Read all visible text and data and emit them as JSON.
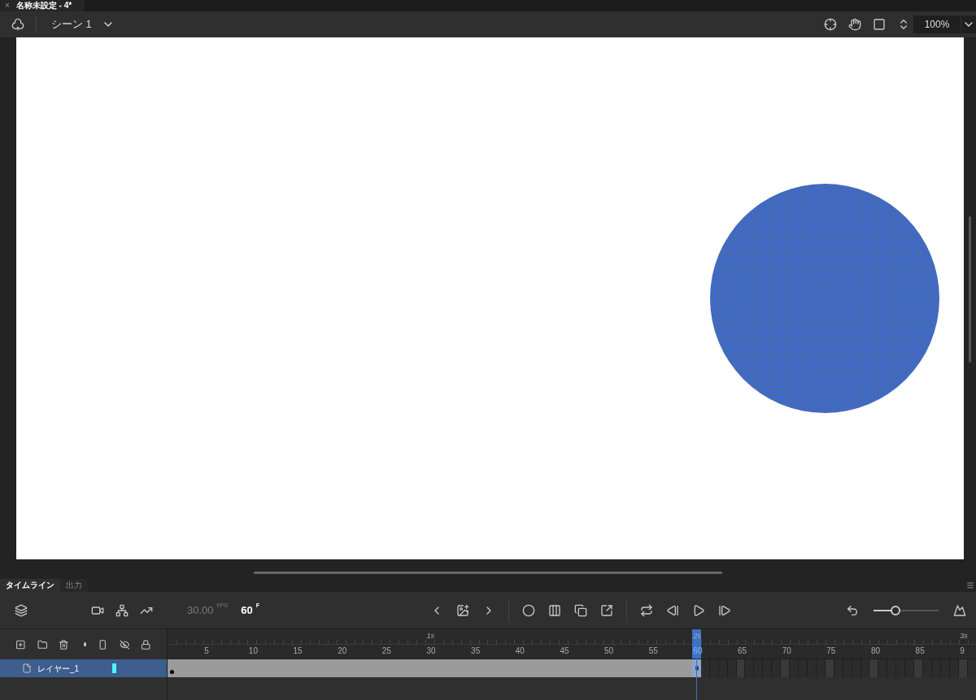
{
  "document_tab": {
    "title": "名称未設定 - 4*",
    "close": "×"
  },
  "toolbar": {
    "scene": "シーン 1",
    "zoom": "100%"
  },
  "panel_tabs": [
    {
      "label": "タイムライン",
      "selected": true
    },
    {
      "label": "出力",
      "selected": false
    }
  ],
  "timeline": {
    "fps": "30.00",
    "fps_unit": "FPS",
    "frame": "60",
    "frame_unit": "F",
    "zoom_slider": {
      "level": 0.34
    },
    "seconds": [
      "1s",
      "2s",
      "3s"
    ],
    "frame_numbers": [
      {
        "label": "5",
        "selected": false
      },
      {
        "label": "10",
        "selected": false
      },
      {
        "label": "15",
        "selected": false
      },
      {
        "label": "20",
        "selected": false
      },
      {
        "label": "25",
        "selected": false
      },
      {
        "label": "30",
        "selected": false
      },
      {
        "label": "35",
        "selected": false
      },
      {
        "label": "40",
        "selected": false
      },
      {
        "label": "45",
        "selected": false
      },
      {
        "label": "50",
        "selected": false
      },
      {
        "label": "55",
        "selected": false
      },
      {
        "label": "60",
        "selected": true
      },
      {
        "label": "65",
        "selected": false
      },
      {
        "label": "70",
        "selected": false
      },
      {
        "label": "75",
        "selected": false
      },
      {
        "label": "80",
        "selected": false
      },
      {
        "label": "85",
        "selected": false
      },
      {
        "label": "9",
        "selected": false
      }
    ],
    "layers": [
      {
        "name": "レイヤー_1",
        "selected": true,
        "color": "#4ef2ff"
      }
    ]
  }
}
